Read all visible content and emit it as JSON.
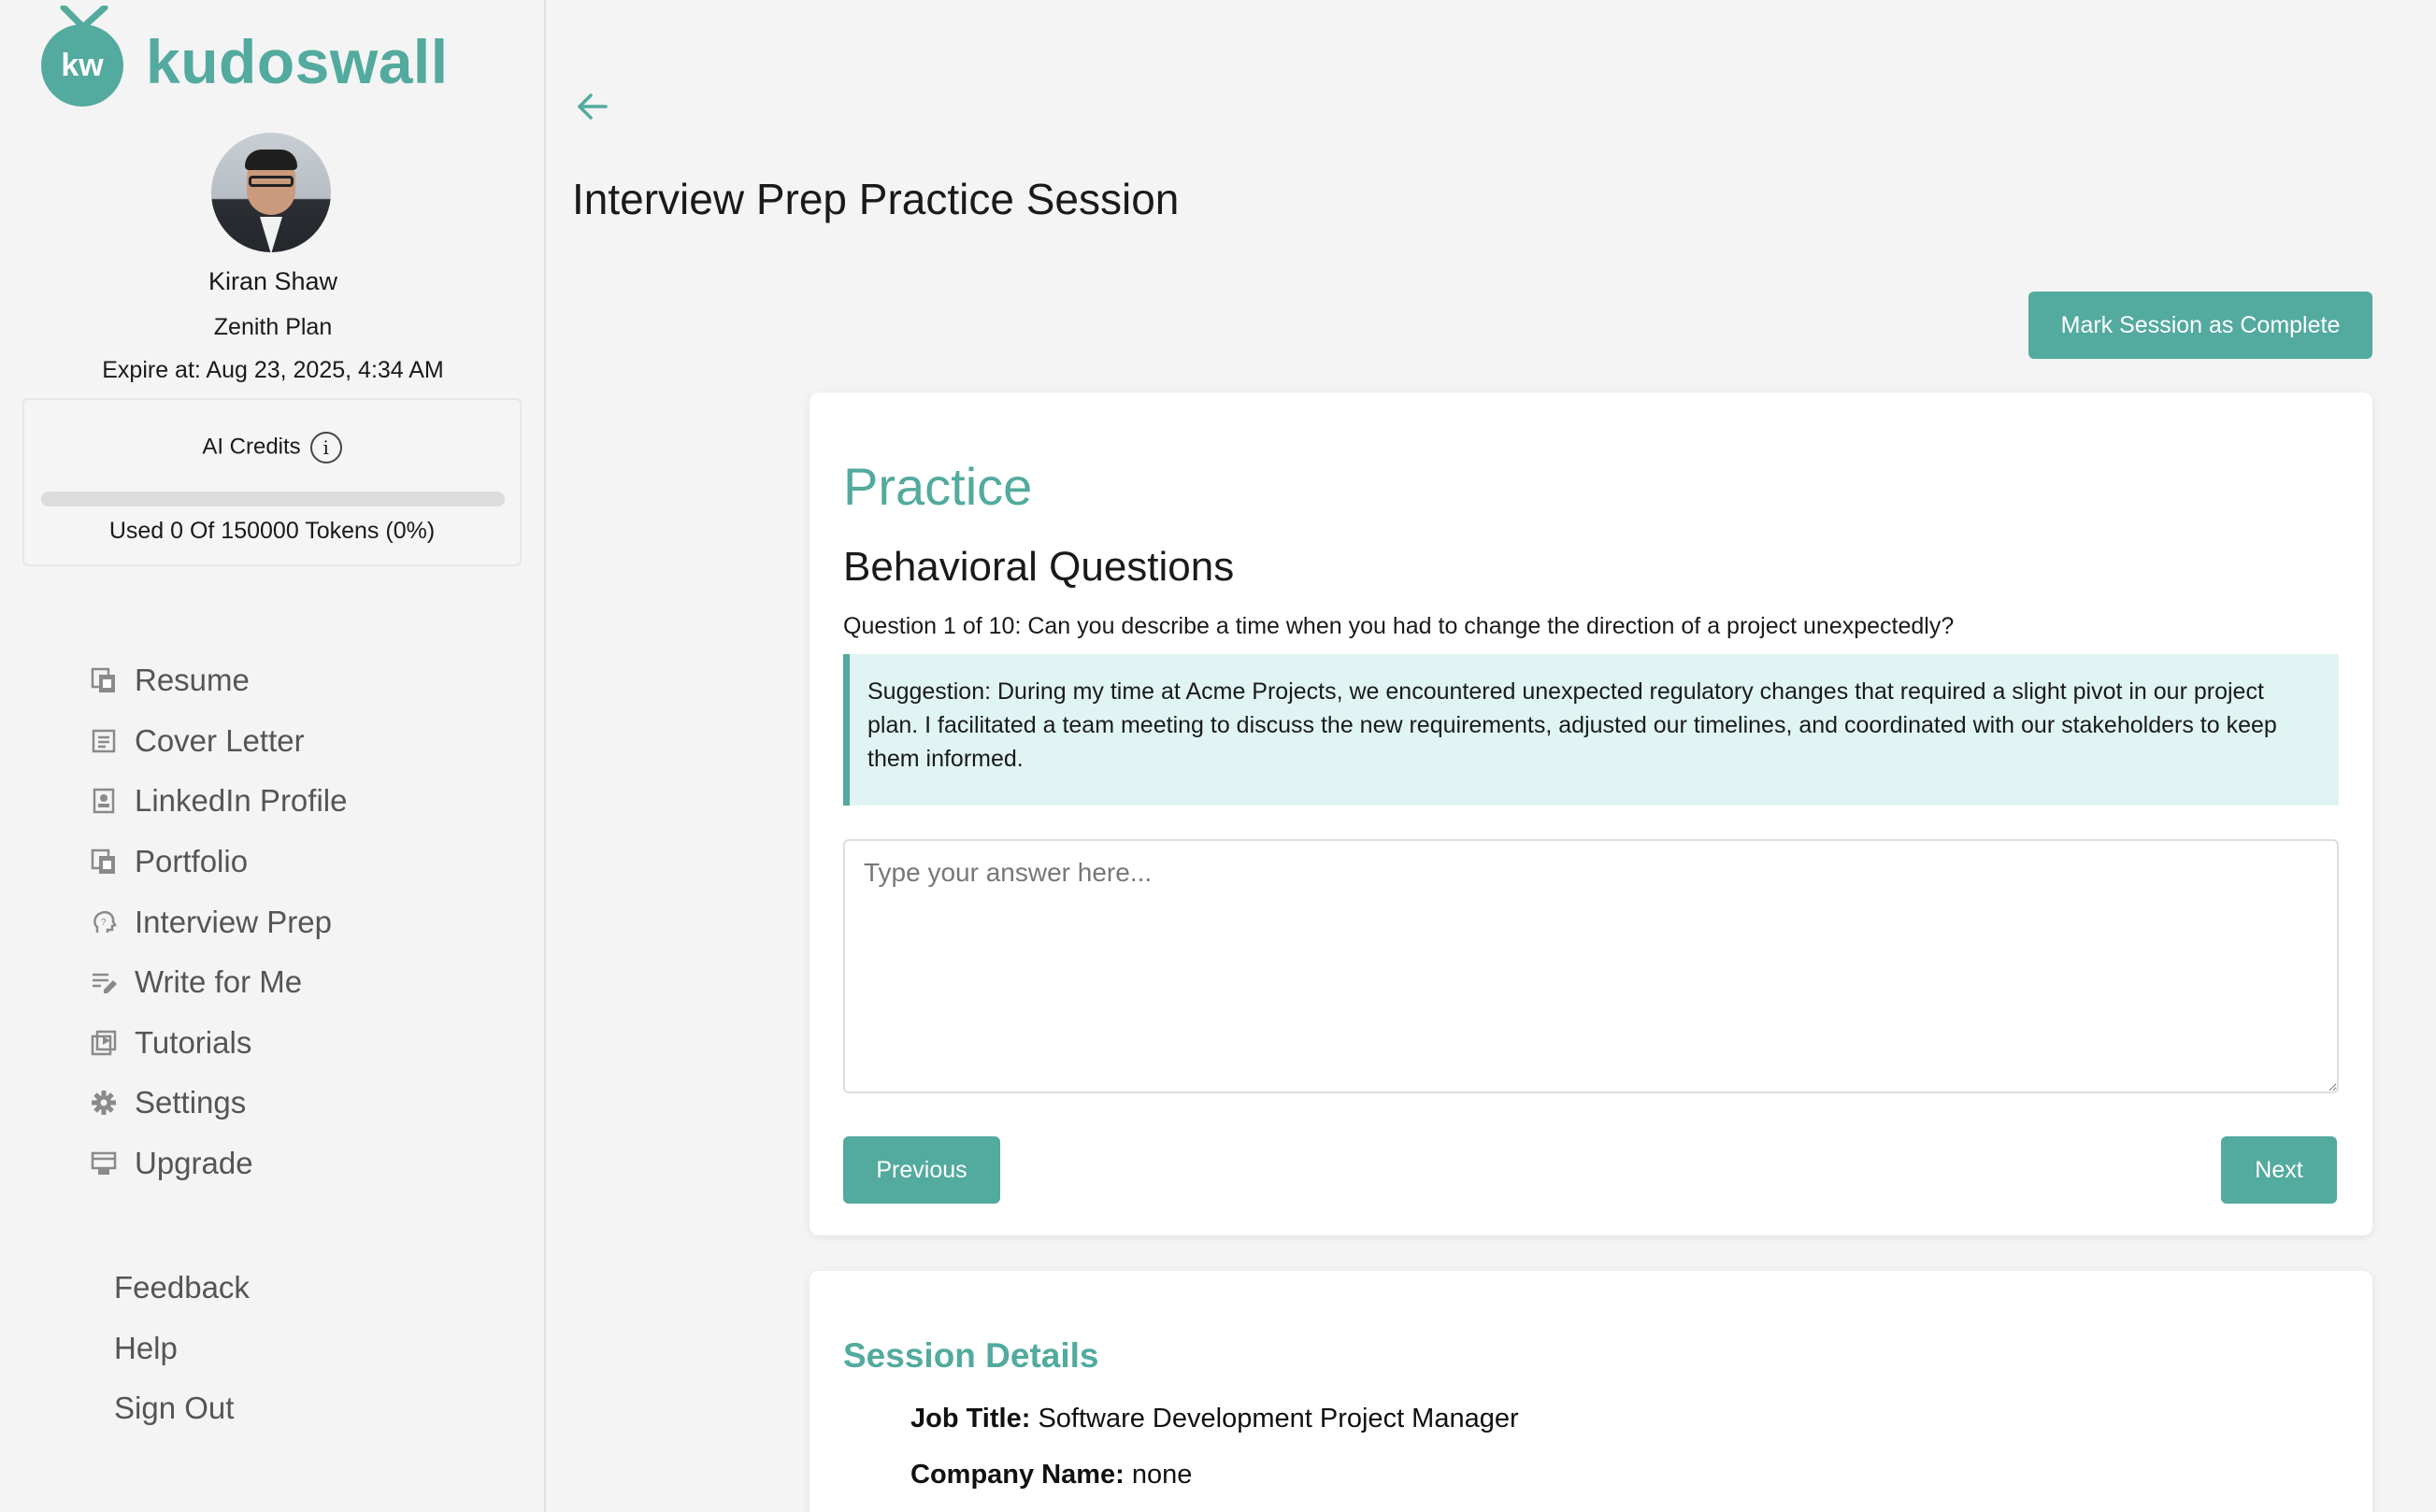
{
  "brand": {
    "logo_initials": "kw",
    "name": "kudoswall",
    "accent": "#53aa9e"
  },
  "user": {
    "name": "Kiran Shaw",
    "plan": "Zenith Plan",
    "expire": "Expire at: Aug 23, 2025, 4:34 AM"
  },
  "credits": {
    "title": "AI Credits",
    "used_text": "Used 0 Of 150000 Tokens (0%)",
    "used_fraction": 0
  },
  "nav": {
    "items": [
      {
        "label": "Resume",
        "icon": "resume-icon"
      },
      {
        "label": "Cover Letter",
        "icon": "cover-letter-icon"
      },
      {
        "label": "LinkedIn Profile",
        "icon": "linkedin-profile-icon"
      },
      {
        "label": "Portfolio",
        "icon": "portfolio-icon"
      },
      {
        "label": "Interview Prep",
        "icon": "interview-prep-icon"
      },
      {
        "label": "Write for Me",
        "icon": "write-icon"
      },
      {
        "label": "Tutorials",
        "icon": "tutorials-icon"
      },
      {
        "label": "Settings",
        "icon": "gear-icon"
      },
      {
        "label": "Upgrade",
        "icon": "upgrade-icon"
      }
    ],
    "footer": [
      "Feedback",
      "Help",
      "Sign Out"
    ]
  },
  "page": {
    "title": "Interview Prep Practice Session",
    "mark_complete": "Mark Session as Complete"
  },
  "practice": {
    "title": "Practice",
    "section": "Behavioral Questions",
    "question": "Question 1 of 10: Can you describe a time when you had to change the direction of a project unexpectedly?",
    "suggestion": "Suggestion: During my time at Acme Projects, we encountered unexpected regulatory changes that required a slight pivot in our project plan. I facilitated a team meeting to discuss the new requirements, adjusted our timelines, and coordinated with our stakeholders to keep them informed.",
    "answer_placeholder": "Type your answer here...",
    "answer_value": "",
    "previous": "Previous",
    "next": "Next"
  },
  "session": {
    "title": "Session Details",
    "job_title_label": "Job Title:",
    "job_title": "Software Development Project Manager",
    "company_label": "Company Name:",
    "company": "none"
  }
}
